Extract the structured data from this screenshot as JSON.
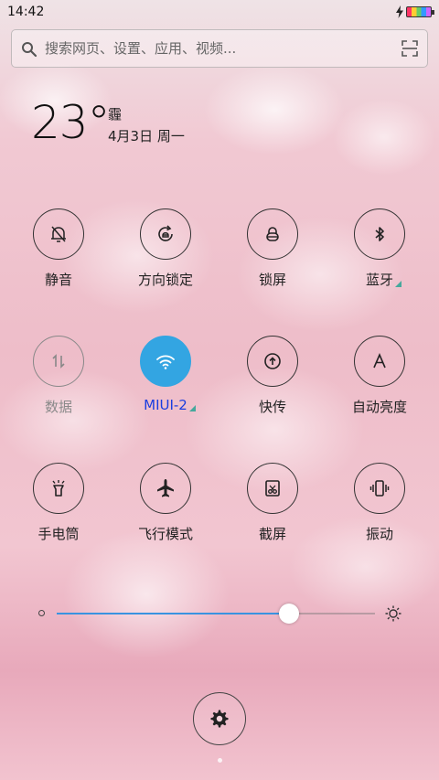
{
  "status_bar": {
    "time": "14:42"
  },
  "search": {
    "placeholder": "搜索网页、设置、应用、视频..."
  },
  "weather": {
    "temperature": "23°",
    "condition": "霾",
    "date": "4月3日 周一"
  },
  "toggles": [
    {
      "label": "静音",
      "icon": "bell-off-icon",
      "state": "off"
    },
    {
      "label": "方向锁定",
      "icon": "rotation-lock-icon",
      "state": "off"
    },
    {
      "label": "锁屏",
      "icon": "lock-icon",
      "state": "off"
    },
    {
      "label": "蓝牙",
      "icon": "bluetooth-icon",
      "state": "off"
    },
    {
      "label": "数据",
      "icon": "mobile-data-icon",
      "state": "disabled"
    },
    {
      "label": "MIUI-2",
      "icon": "wifi-icon",
      "state": "on"
    },
    {
      "label": "快传",
      "icon": "share-upload-icon",
      "state": "off"
    },
    {
      "label": "自动亮度",
      "icon": "auto-brightness-icon",
      "state": "off"
    },
    {
      "label": "手电筒",
      "icon": "flashlight-icon",
      "state": "off"
    },
    {
      "label": "飞行模式",
      "icon": "airplane-icon",
      "state": "off"
    },
    {
      "label": "截屏",
      "icon": "screenshot-icon",
      "state": "off"
    },
    {
      "label": "振动",
      "icon": "vibrate-icon",
      "state": "off"
    }
  ],
  "brightness": {
    "level": 0.73
  },
  "colors": {
    "accent": "#33a5e2",
    "wifi_label": "#1a3de0",
    "slider_fill": "#3a93e0"
  }
}
